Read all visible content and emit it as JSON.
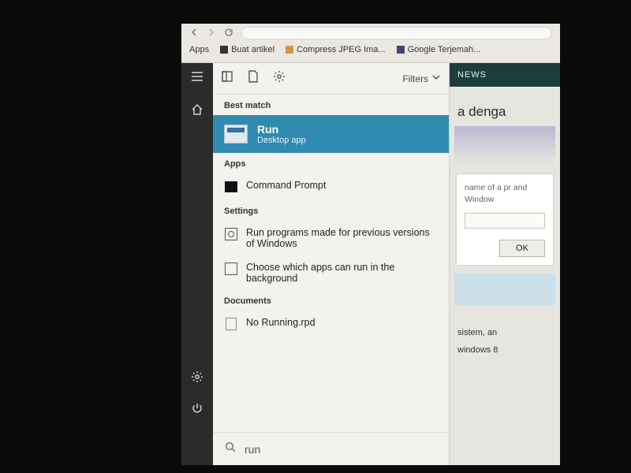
{
  "browser": {
    "bookmarks_label": "Apps",
    "bookmarks": [
      "Buat artikel",
      "Compress JPEG Ima...",
      "Google Terjemah..."
    ]
  },
  "search_panel": {
    "filters_label": "Filters",
    "sections": {
      "best_match": "Best match",
      "apps": "Apps",
      "settings": "Settings",
      "documents": "Documents"
    },
    "best_match": {
      "title": "Run",
      "subtitle": "Desktop app"
    },
    "apps": [
      {
        "label": "Command Prompt"
      }
    ],
    "settings": [
      {
        "label": "Run programs made for previous versions of Windows"
      },
      {
        "label": "Choose which apps can run in the background"
      }
    ],
    "documents": [
      {
        "label": "No Running.rpd"
      }
    ],
    "query": "run"
  },
  "right_pane": {
    "tab": "NEWS",
    "headline_fragment": "a denga",
    "run_dialog": {
      "hint": "name of a pr and Window",
      "ok": "OK"
    },
    "body_lines": [
      "sistem, an",
      "windows 8"
    ]
  }
}
